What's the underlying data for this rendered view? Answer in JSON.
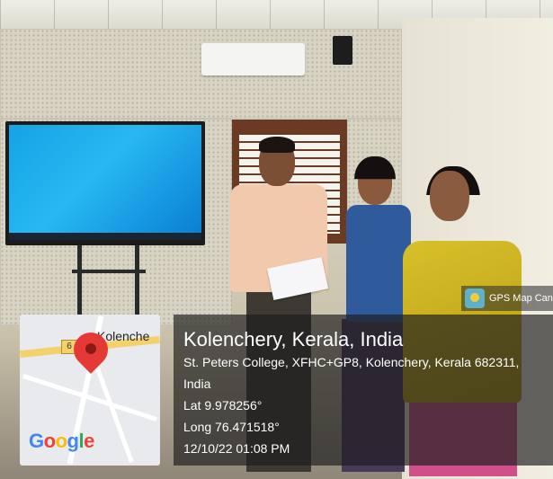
{
  "overlay": {
    "title": "Kolenchery, Kerala, India",
    "address_line1": "St. Peters College, XFHC+GP8, Kolenchery, Kerala 682311,",
    "address_line2": "India",
    "latitude": "Lat 9.978256°",
    "longitude": "Long 76.471518°",
    "datetime": "12/10/22 01:08 PM"
  },
  "map": {
    "town_label": "Kolenche",
    "route_label": "6",
    "logo": [
      "G",
      "o",
      "o",
      "g",
      "l",
      "e"
    ],
    "pin_icon": "location-pin-icon"
  },
  "watermark": {
    "label": "GPS Map Can",
    "icon": "gps-map-camera-icon"
  },
  "colors": {
    "overlay_bg": "#1e1e1e",
    "pin": "#e53935",
    "screen": "#1ea9ea"
  }
}
